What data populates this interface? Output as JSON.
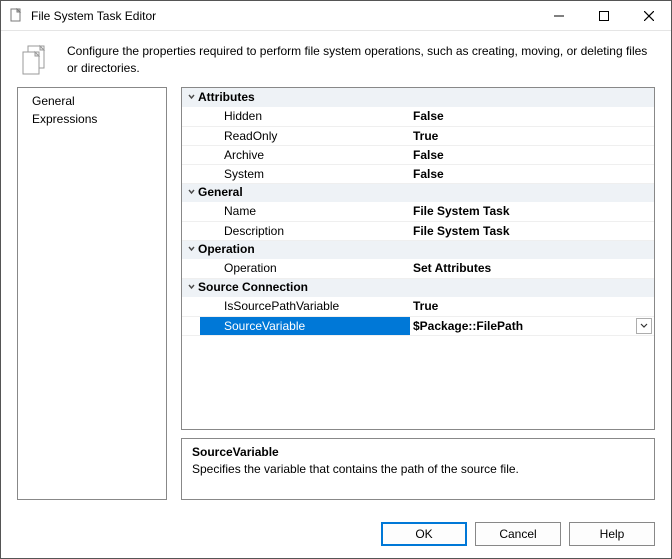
{
  "window": {
    "title": "File System Task Editor"
  },
  "header": {
    "description": "Configure the properties required to perform file system operations, such as creating, moving, or deleting files or directories."
  },
  "sidebar": {
    "items": [
      {
        "label": "General"
      },
      {
        "label": "Expressions"
      }
    ]
  },
  "propgrid": {
    "groups": [
      {
        "label": "Attributes",
        "rows": [
          {
            "name": "Hidden",
            "value": "False"
          },
          {
            "name": "ReadOnly",
            "value": "True"
          },
          {
            "name": "Archive",
            "value": "False"
          },
          {
            "name": "System",
            "value": "False"
          }
        ]
      },
      {
        "label": "General",
        "rows": [
          {
            "name": "Name",
            "value": "File System Task"
          },
          {
            "name": "Description",
            "value": "File System Task"
          }
        ]
      },
      {
        "label": "Operation",
        "rows": [
          {
            "name": "Operation",
            "value": "Set Attributes"
          }
        ]
      },
      {
        "label": "Source Connection",
        "rows": [
          {
            "name": "IsSourcePathVariable",
            "value": "True"
          },
          {
            "name": "SourceVariable",
            "value": "$Package::FilePath",
            "selected": true,
            "dropdown": true
          }
        ]
      }
    ]
  },
  "helppane": {
    "title": "SourceVariable",
    "desc": "Specifies the variable that contains the path of the source file."
  },
  "footer": {
    "ok": "OK",
    "cancel": "Cancel",
    "help": "Help"
  }
}
